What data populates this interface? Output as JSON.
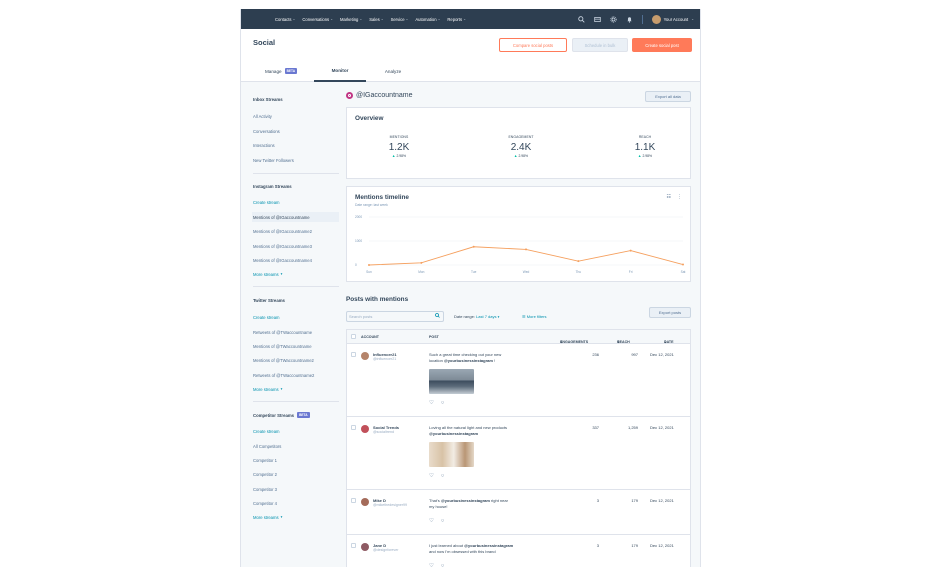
{
  "nav": {
    "items": [
      "Contacts",
      "Conversations",
      "Marketing",
      "Sales",
      "Service",
      "Automation",
      "Reports"
    ],
    "account": "Your Account"
  },
  "header": {
    "title": "Social",
    "compare_btn": "Compare social posts",
    "schedule_btn": "Schedule in bulk",
    "create_btn": "Create social post",
    "tabs": {
      "manage": "Manage",
      "manage_badge": "BETA",
      "monitor": "Monitor",
      "analyze": "Analyze"
    }
  },
  "sidebar": {
    "inbox": {
      "title": "Inbox Streams",
      "items": [
        "All Activity",
        "Conversations",
        "Interactions",
        "New Twitter Followers"
      ]
    },
    "instagram": {
      "title": "Instagram Streams",
      "create": "Create stream",
      "items": [
        "Mentions of @IGaccountname",
        "Mentions of @IGaccountname2",
        "Mentions of @IGaccountname3",
        "Mentions of @IGaccountname4"
      ],
      "more": "More streams"
    },
    "twitter": {
      "title": "Twitter Streams",
      "create": "Create stream",
      "items": [
        "Retweets of @TWaccountname",
        "Mentions of @TWaccountname",
        "Mentions of @TWaccountname2",
        "Retweets of @TWaccountname2"
      ],
      "more": "More streams"
    },
    "competitor": {
      "title": "Competitor Streams",
      "badge": "BETA",
      "create": "Create stream",
      "items": [
        "All Competitors",
        "Competitor 1",
        "Competitor 2",
        "Competitor 3",
        "Competitor 4"
      ],
      "more": "More streams"
    }
  },
  "main": {
    "account_name": "@IGaccountname",
    "export_all": "Export all data",
    "overview": {
      "title": "Overview",
      "kpis": [
        {
          "label": "MENTIONS",
          "value": "1.2K",
          "change": "2.98%"
        },
        {
          "label": "ENGAGEMENT",
          "value": "2.4K",
          "change": "2.98%"
        },
        {
          "label": "REACH",
          "value": "1.1K",
          "change": "2.98%"
        }
      ]
    },
    "timeline": {
      "title": "Mentions timeline",
      "subtitle": "Date range: last week"
    },
    "posts": {
      "title": "Posts with mentions",
      "search_placeholder": "Search posts",
      "date_range_label": "Date range:",
      "date_range_value": "Last 7 days",
      "more_filters": "More filters",
      "export": "Export posts",
      "columns": {
        "account": "ACCOUNT",
        "post": "POST",
        "engagements": "ENGAGEMENTS",
        "reach": "REACH",
        "date": "DATE"
      },
      "rows": [
        {
          "name": "Influencer21",
          "handle": "@influencer21",
          "text1": "Such a great time checking out your new",
          "text2_pre": "location ",
          "text2_mention": "@yourbusinessinstagram",
          "text2_post": " !",
          "engagements": "236",
          "reach": "997",
          "date": "Dec 12, 2021"
        },
        {
          "name": "Social Trends",
          "handle": "@socialtrend",
          "text1": "Loving all the natural light and new products",
          "text2_pre": "",
          "text2_mention": "@yourbusinessinstagram",
          "text2_post": "",
          "engagements": "337",
          "reach": "1,259",
          "date": "Dec 12, 2021"
        },
        {
          "name": "Mike D",
          "handle": "@mikethedesigner99",
          "text1_pre": "That's ",
          "text1_mention": "@yourbusinessinstagram",
          "text1_post": " right near",
          "text2": "my house!",
          "engagements": "3",
          "reach": "179",
          "date": "Dec 12, 2021"
        },
        {
          "name": "Jane D",
          "handle": "@designforever",
          "text1_pre": "I just learned about ",
          "text1_mention": "@yourbusinessinstagram",
          "text1_post": "",
          "text2": "and now I'm obsessed with this brand",
          "engagements": "3",
          "reach": "179",
          "date": "Dec 12, 2021"
        }
      ]
    }
  },
  "chart_data": {
    "type": "line",
    "categories": [
      "Sun",
      "Mon",
      "Tue",
      "Wed",
      "Thu",
      "Fri",
      "Sat"
    ],
    "values": [
      0,
      90,
      760,
      650,
      160,
      600,
      20
    ],
    "yticks": [
      "0",
      "1000",
      "2000"
    ],
    "ylim": [
      0,
      2000
    ],
    "color": "#f5a05f"
  }
}
